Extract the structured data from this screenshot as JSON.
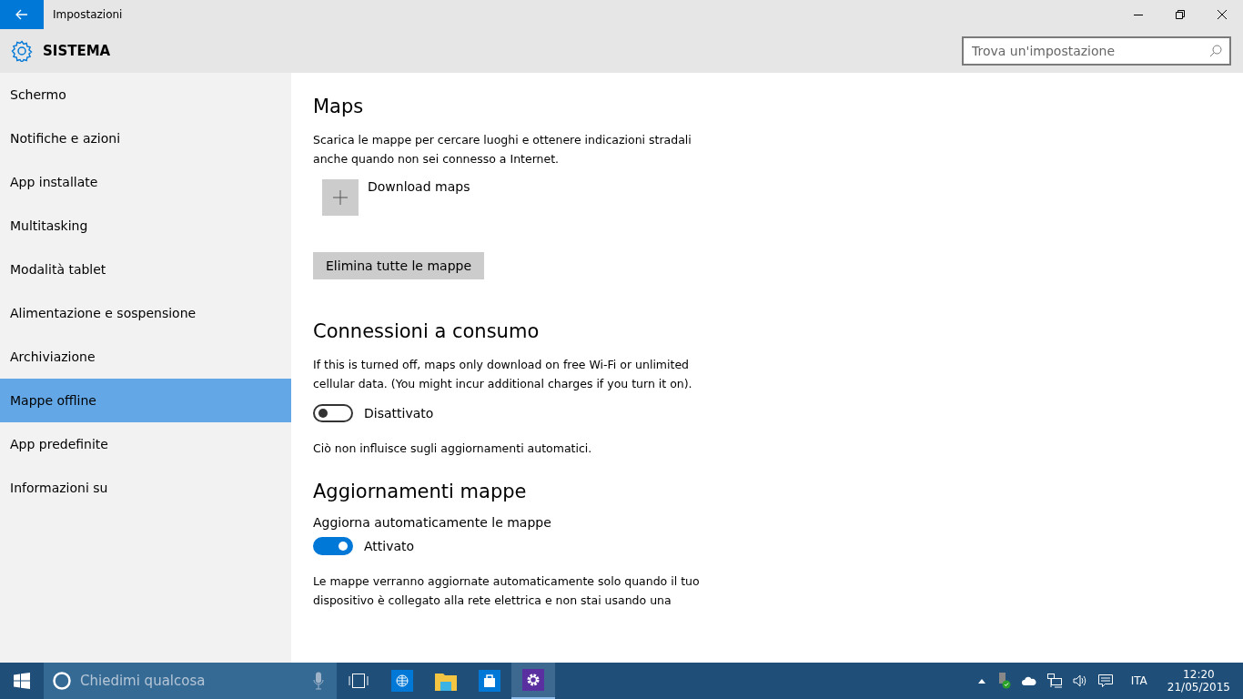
{
  "window": {
    "title": "Impostazioni"
  },
  "header": {
    "title": "SISTEMA",
    "search": {
      "placeholder": "Trova un'impostazione"
    }
  },
  "sidebar": {
    "items": [
      {
        "label": "Schermo",
        "selected": false
      },
      {
        "label": "Notifiche e azioni",
        "selected": false
      },
      {
        "label": "App installate",
        "selected": false
      },
      {
        "label": "Multitasking",
        "selected": false
      },
      {
        "label": "Modalità tablet",
        "selected": false
      },
      {
        "label": "Alimentazione e sospensione",
        "selected": false
      },
      {
        "label": "Archiviazione",
        "selected": false
      },
      {
        "label": "Mappe offline",
        "selected": true
      },
      {
        "label": "App predefinite",
        "selected": false
      },
      {
        "label": "Informazioni su",
        "selected": false
      }
    ]
  },
  "sections": [
    {
      "title": "Maps",
      "items": [
        {
          "kind": "text",
          "text": "Scarica le mappe per cercare luoghi e ottenere indicazioni stradali anche quando non sei connesso a Internet."
        },
        {
          "kind": "add",
          "text": "Download maps"
        },
        {
          "kind": "button",
          "text": "Elimina tutte le mappe"
        }
      ]
    },
    {
      "title": "Connessioni a consumo",
      "items": [
        {
          "kind": "text",
          "text": "If this is turned off, maps only download on free Wi-Fi or unlimited cellular data. (You might incur additional charges if you turn it on)."
        },
        {
          "kind": "toggle",
          "on": false,
          "text": "Disattivato"
        },
        {
          "kind": "text",
          "text": "Ciò non influisce sugli aggiornamenti automatici."
        }
      ]
    },
    {
      "title": "Aggiornamenti mappe",
      "items": [
        {
          "kind": "label",
          "text": "Aggiorna automaticamente le mappe"
        },
        {
          "kind": "toggle",
          "on": true,
          "text": "Attivato"
        },
        {
          "kind": "text",
          "text": "Le mappe verranno aggiornate automaticamente solo quando il tuo dispositivo è collegato alla rete elettrica e non stai usando una"
        }
      ]
    }
  ],
  "taskbar": {
    "search": {
      "placeholder": "Chiedimi qualcosa"
    },
    "apps": [
      {
        "kind": "taskview",
        "selected": false
      },
      {
        "kind": "browser",
        "selected": false
      },
      {
        "kind": "folder",
        "selected": false
      },
      {
        "kind": "store",
        "selected": false
      },
      {
        "kind": "settings",
        "selected": true
      }
    ],
    "language": "ITA",
    "time": "12:20",
    "date": "21/05/2015"
  }
}
